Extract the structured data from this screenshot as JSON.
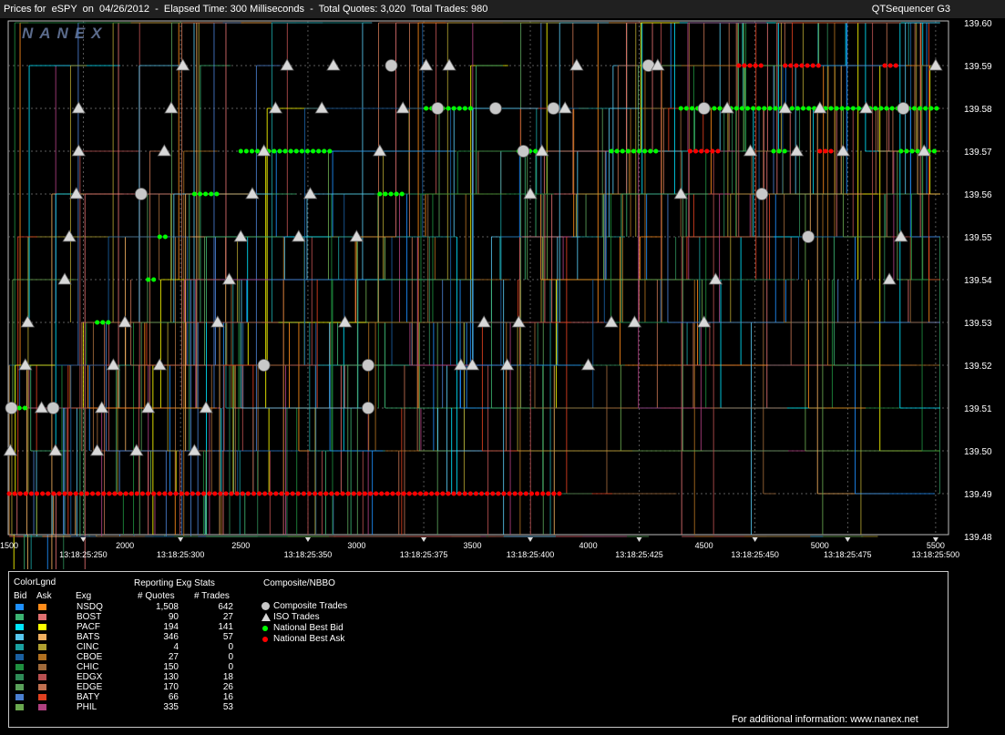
{
  "header": {
    "title_left": "Prices for  eSPY  on  04/26/2012  -  Elapsed Time: 300 Milliseconds  -  Total Quotes: 3,020  Total Trades: 980",
    "title_right": "QTSequencer G3",
    "logo": "NANEX"
  },
  "chart_data": {
    "type": "scatter",
    "title": "Prices for eSPY on 04/26/2012",
    "y_ticks": [
      "139.60",
      "139.59",
      "139.58",
      "139.57",
      "139.56",
      "139.55",
      "139.54",
      "139.53",
      "139.52",
      "139.51",
      "139.50",
      "139.49",
      "139.48"
    ],
    "ylim": [
      139.48,
      139.6
    ],
    "x_seq_ticks": [
      "1500",
      "2000",
      "2500",
      "3000",
      "3500",
      "4000",
      "4500",
      "5000",
      "5500"
    ],
    "xlim": [
      1500,
      5520
    ],
    "x_time_ticks": [
      "13:18:25:250",
      "13:18:25:300",
      "13:18:25:350",
      "13:18:25:375",
      "13:18:25:400",
      "13:18:25:425",
      "13:18:25:450",
      "13:18:25:475",
      "13:18:25:500"
    ],
    "x_time_tick_seq": [
      1820,
      2240,
      2790,
      3290,
      3750,
      4220,
      4720,
      5120,
      5500
    ],
    "grid": true,
    "series": [
      {
        "name": "National Best Bid",
        "color": "#00ff00",
        "segments": [
          [
            1500,
            1520,
            139.51
          ],
          [
            1520,
            1590,
            139.51
          ],
          [
            1880,
            1950,
            139.53
          ],
          [
            2100,
            2140,
            139.54
          ],
          [
            2150,
            2180,
            139.55
          ],
          [
            2300,
            2400,
            139.56
          ],
          [
            2500,
            2900,
            139.57
          ],
          [
            3100,
            3200,
            139.56
          ],
          [
            3300,
            3500,
            139.58
          ],
          [
            3700,
            3800,
            139.57
          ],
          [
            4100,
            4300,
            139.57
          ],
          [
            4400,
            5520,
            139.58
          ],
          [
            4800,
            4850,
            139.57
          ],
          [
            5350,
            5500,
            139.57
          ]
        ]
      },
      {
        "name": "National Best Ask",
        "color": "#ff0000",
        "segments": [
          [
            1500,
            3890,
            139.49
          ],
          [
            4440,
            4560,
            139.57
          ],
          [
            4650,
            4760,
            139.59
          ],
          [
            4850,
            5000,
            139.59
          ],
          [
            5000,
            5060,
            139.57
          ],
          [
            5280,
            5340,
            139.59
          ]
        ]
      },
      {
        "name": "Composite Trades",
        "color": "#c8c8c8",
        "points": [
          [
            1510,
            139.51
          ],
          [
            1690,
            139.51
          ],
          [
            2070,
            139.56
          ],
          [
            2600,
            139.52
          ],
          [
            3050,
            139.52
          ],
          [
            3050,
            139.51
          ],
          [
            3150,
            139.59
          ],
          [
            3350,
            139.58
          ],
          [
            3600,
            139.58
          ],
          [
            3720,
            139.57
          ],
          [
            3850,
            139.58
          ],
          [
            4260,
            139.59
          ],
          [
            4500,
            139.58
          ],
          [
            4750,
            139.56
          ],
          [
            4950,
            139.55
          ],
          [
            5360,
            139.58
          ]
        ]
      },
      {
        "name": "ISO Trades",
        "color": "#d8d8d8",
        "points": [
          [
            1505,
            139.5
          ],
          [
            1570,
            139.52
          ],
          [
            1580,
            139.53
          ],
          [
            1640,
            139.51
          ],
          [
            1700,
            139.5
          ],
          [
            1740,
            139.54
          ],
          [
            1760,
            139.55
          ],
          [
            1790,
            139.56
          ],
          [
            1800,
            139.57
          ],
          [
            1800,
            139.58
          ],
          [
            1880,
            139.5
          ],
          [
            1900,
            139.51
          ],
          [
            1950,
            139.52
          ],
          [
            2000,
            139.53
          ],
          [
            2050,
            139.5
          ],
          [
            2100,
            139.51
          ],
          [
            2150,
            139.52
          ],
          [
            2170,
            139.57
          ],
          [
            2200,
            139.58
          ],
          [
            2250,
            139.59
          ],
          [
            2300,
            139.5
          ],
          [
            2350,
            139.51
          ],
          [
            2400,
            139.53
          ],
          [
            2450,
            139.54
          ],
          [
            2500,
            139.55
          ],
          [
            2550,
            139.56
          ],
          [
            2600,
            139.57
          ],
          [
            2650,
            139.58
          ],
          [
            2700,
            139.59
          ],
          [
            2750,
            139.55
          ],
          [
            2800,
            139.56
          ],
          [
            2850,
            139.58
          ],
          [
            2900,
            139.59
          ],
          [
            2950,
            139.53
          ],
          [
            3000,
            139.55
          ],
          [
            3100,
            139.57
          ],
          [
            3200,
            139.58
          ],
          [
            3300,
            139.59
          ],
          [
            3400,
            139.59
          ],
          [
            3450,
            139.52
          ],
          [
            3500,
            139.52
          ],
          [
            3550,
            139.53
          ],
          [
            3650,
            139.52
          ],
          [
            3700,
            139.53
          ],
          [
            3750,
            139.56
          ],
          [
            3800,
            139.57
          ],
          [
            3900,
            139.58
          ],
          [
            3950,
            139.59
          ],
          [
            4000,
            139.52
          ],
          [
            4100,
            139.53
          ],
          [
            4200,
            139.53
          ],
          [
            4300,
            139.59
          ],
          [
            4400,
            139.56
          ],
          [
            4500,
            139.53
          ],
          [
            4550,
            139.54
          ],
          [
            4600,
            139.58
          ],
          [
            4700,
            139.57
          ],
          [
            4850,
            139.58
          ],
          [
            4900,
            139.57
          ],
          [
            5000,
            139.58
          ],
          [
            5100,
            139.57
          ],
          [
            5200,
            139.58
          ],
          [
            5300,
            139.54
          ],
          [
            5350,
            139.55
          ],
          [
            5450,
            139.57
          ],
          [
            5500,
            139.59
          ]
        ]
      }
    ]
  },
  "legend": {
    "colorlgnd_label": "ColorLgnd",
    "bid_header": "Bid",
    "ask_header": "Ask",
    "exg_header": "Exg",
    "stats_title": "Reporting Exg Stats",
    "quotes_header": "# Quotes",
    "trades_header": "# Trades",
    "composite_title": "Composite/NBBO",
    "exchanges": [
      {
        "name": "NSDQ",
        "quotes": "1,508",
        "trades": "642",
        "bid_color": "#1e90ff",
        "ask_color": "#ff8c1a"
      },
      {
        "name": "BOST",
        "quotes": "90",
        "trades": "27",
        "bid_color": "#3cb371",
        "ask_color": "#e07070"
      },
      {
        "name": "PACF",
        "quotes": "194",
        "trades": "141",
        "bid_color": "#00e5ff",
        "ask_color": "#ffff00"
      },
      {
        "name": "BATS",
        "quotes": "346",
        "trades": "57",
        "bid_color": "#58c8f0",
        "ask_color": "#f0b060"
      },
      {
        "name": "CINC",
        "quotes": "4",
        "trades": "0",
        "bid_color": "#1aa0a0",
        "ask_color": "#b0a030"
      },
      {
        "name": "CBOE",
        "quotes": "27",
        "trades": "0",
        "bid_color": "#1a5fa0",
        "ask_color": "#b07020"
      },
      {
        "name": "CHIC",
        "quotes": "150",
        "trades": "0",
        "bid_color": "#1f8f3f",
        "ask_color": "#a06a3a"
      },
      {
        "name": "EDGX",
        "quotes": "130",
        "trades": "18",
        "bid_color": "#2e8b57",
        "ask_color": "#b85050"
      },
      {
        "name": "EDGE",
        "quotes": "170",
        "trades": "26",
        "bid_color": "#5aa05a",
        "ask_color": "#c07050"
      },
      {
        "name": "BATY",
        "quotes": "66",
        "trades": "16",
        "bid_color": "#4a7fd0",
        "ask_color": "#e04020"
      },
      {
        "name": "PHIL",
        "quotes": "335",
        "trades": "53",
        "bid_color": "#6aa84f",
        "ask_color": "#b04080"
      }
    ],
    "composite_items": [
      {
        "label": "Composite Trades",
        "kind": "circle",
        "color": "#c8c8c8"
      },
      {
        "label": "ISO Trades",
        "kind": "triangle",
        "color": "#d8d8d8"
      },
      {
        "label": "National Best Bid",
        "kind": "dot",
        "color": "#00ff00"
      },
      {
        "label": "National Best Ask",
        "kind": "dot",
        "color": "#ff0000"
      }
    ],
    "footer": "For additional information: www.nanex.net"
  }
}
